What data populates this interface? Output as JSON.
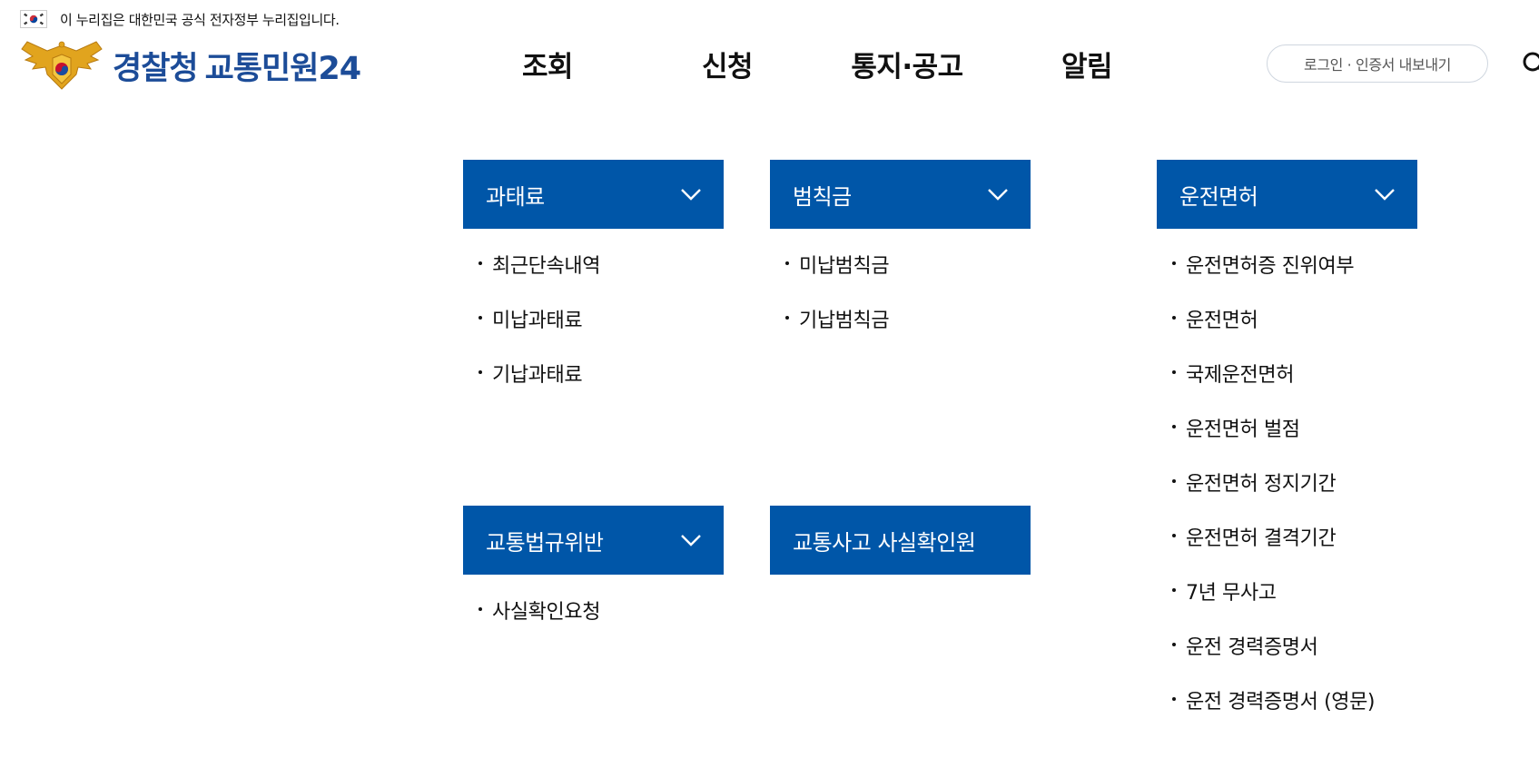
{
  "gov_banner": {
    "text": "이 누리집은 대한민국 공식 전자정부 누리집입니다."
  },
  "logo": {
    "part1": "경찰청",
    "part2": "교통민원24"
  },
  "gnb": {
    "items": [
      "조회",
      "신청",
      "통지·공고",
      "알림"
    ]
  },
  "header": {
    "login_label": "로그인 · 인증서 내보내기"
  },
  "menus": {
    "fine": {
      "title": "과태료",
      "items": [
        "최근단속내역",
        "미납과태료",
        "기납과태료"
      ]
    },
    "penalty": {
      "title": "범칙금",
      "items": [
        "미납범칙금",
        "기납범칙금"
      ]
    },
    "license": {
      "title": "운전면허",
      "items": [
        "운전면허증 진위여부",
        "운전면허",
        "국제운전면허",
        "운전면허 벌점",
        "운전면허 정지기간",
        "운전면허 결격기간",
        "7년 무사고",
        "운전 경력증명서",
        "운전 경력증명서 (영문)"
      ]
    },
    "violation": {
      "title": "교통법규위반",
      "items": [
        "사실확인요청"
      ]
    },
    "accident": {
      "title": "교통사고 사실확인원"
    }
  },
  "colors": {
    "menu_header_bg": "#0056a8",
    "logo_blue": "#1c4c98"
  },
  "icons": [
    "kr-flag-icon",
    "police-emblem-icon",
    "search-icon",
    "chevron-down-icon"
  ]
}
